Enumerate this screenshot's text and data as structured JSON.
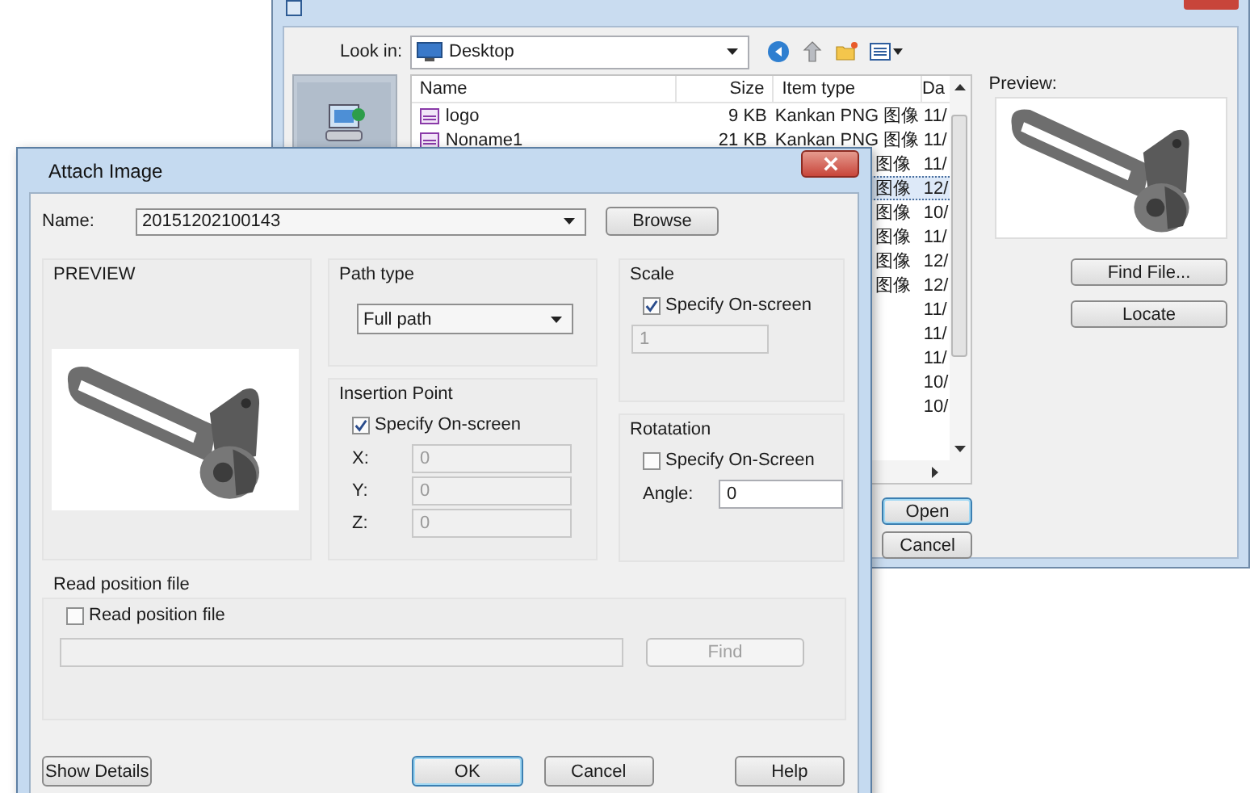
{
  "file_dialog": {
    "look_in": {
      "label": "Look in:",
      "value": "Desktop"
    },
    "columns": [
      "Name",
      "Size",
      "Item type",
      "Da"
    ],
    "rows": [
      {
        "name": "logo",
        "size": "9 KB",
        "item_type": "Kankan PNG 图像",
        "date": "11/",
        "selected": false
      },
      {
        "name": "Noname1",
        "size": "21 KB",
        "item_type": "Kankan PNG 图像",
        "date": "11/",
        "selected": false
      },
      {
        "item_type": "图像",
        "date": "11/",
        "selected": false
      },
      {
        "item_type": "图像",
        "date": "12/",
        "selected": true
      },
      {
        "item_type": "图像",
        "date": "10/",
        "selected": false
      },
      {
        "item_type": "图像",
        "date": "11/",
        "selected": false
      },
      {
        "item_type": "图像",
        "date": "12/",
        "selected": false
      },
      {
        "item_type": "图像",
        "date": "12/",
        "selected": false
      },
      {
        "date": "11/",
        "selected": false
      },
      {
        "date": "11/",
        "selected": false
      },
      {
        "date": "11/",
        "selected": false
      },
      {
        "date": "10/",
        "selected": false
      },
      {
        "date": "10/",
        "selected": false
      }
    ],
    "preview_label": "Preview:",
    "side_buttons": [
      "Find File...",
      "Locate"
    ],
    "dialog_buttons": [
      {
        "label": "Open",
        "default": true
      },
      {
        "label": "Cancel",
        "default": false
      }
    ]
  },
  "attach_dialog": {
    "title": "Attach Image",
    "name": {
      "label": "Name:",
      "value": "20151202100143"
    },
    "browse": "Browse",
    "preview_label": "PREVIEW",
    "path_type": {
      "label": "Path type",
      "value": "Full path"
    },
    "insertion_point": {
      "label": "Insertion Point",
      "checkbox": {
        "label": "Specify On-screen",
        "checked": true
      },
      "fields": [
        {
          "label": "X:",
          "value": "0",
          "disabled": true
        },
        {
          "label": "Y:",
          "value": "0",
          "disabled": true
        },
        {
          "label": "Z:",
          "value": "0",
          "disabled": true
        }
      ]
    },
    "scale": {
      "label": "Scale",
      "checkbox": {
        "label": "Specify On-screen",
        "checked": true
      },
      "field": {
        "value": "1",
        "disabled": true
      }
    },
    "rotation": {
      "label": "Rotatation",
      "checkbox": {
        "label": "Specify On-Screen",
        "checked": false
      },
      "angle": {
        "label": "Angle:",
        "value": "0",
        "disabled": false
      }
    },
    "read_position": {
      "label": "Read position file",
      "checkbox": {
        "label": "Read position file",
        "checked": false
      },
      "path_field": {
        "disabled": true
      },
      "find": {
        "label": "Find",
        "disabled": true
      }
    },
    "buttons": [
      {
        "label": "Show Details",
        "default": false
      },
      {
        "label": "OK",
        "default": true
      },
      {
        "label": "Cancel",
        "default": false
      },
      {
        "label": "Help",
        "default": false
      }
    ]
  }
}
